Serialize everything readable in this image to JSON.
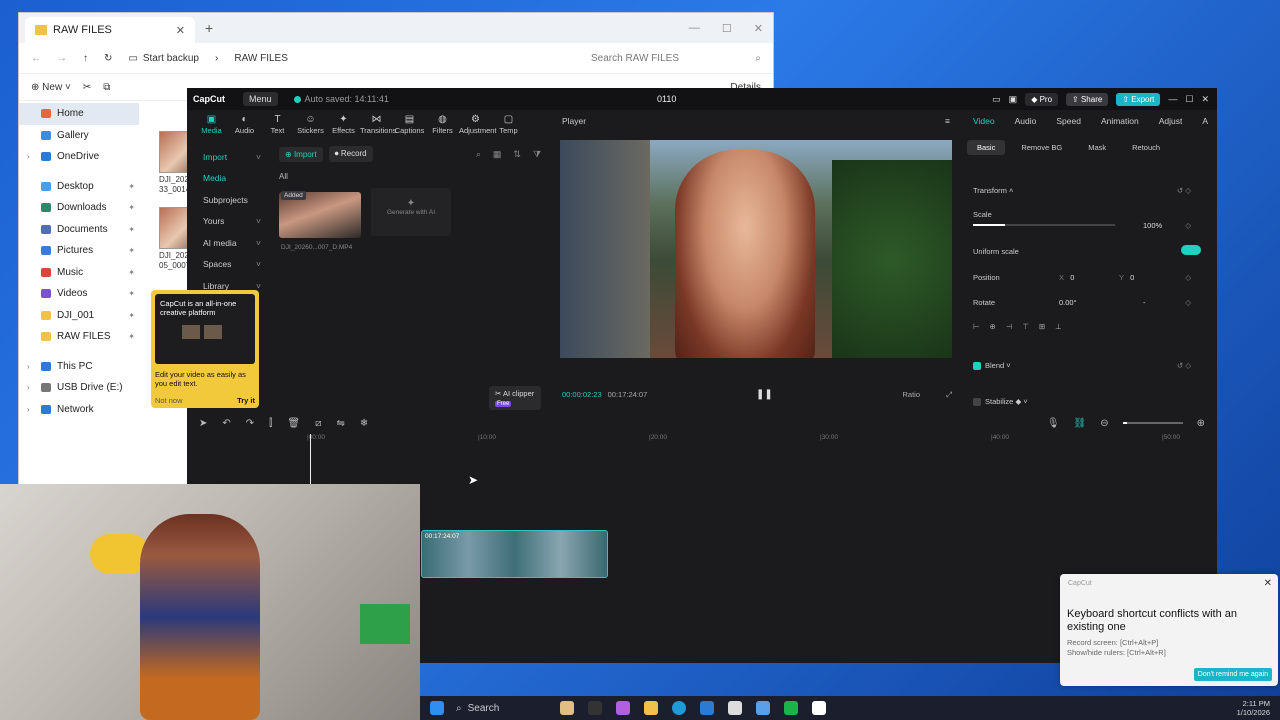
{
  "explorer": {
    "tab_title": "RAW FILES",
    "breadcrumb_backup": "Start backup",
    "breadcrumb_folder": "RAW FILES",
    "search_placeholder": "Search RAW FILES",
    "new_label": "New",
    "details_label": "Details",
    "sidebar": [
      {
        "label": "Home",
        "color": "#e26a3a",
        "selected": true
      },
      {
        "label": "Gallery",
        "color": "#3a8de2"
      },
      {
        "label": "OneDrive",
        "color": "#2d79d3"
      },
      {
        "label": "Desktop",
        "color": "#4a9ee8"
      },
      {
        "label": "Downloads",
        "color": "#2c8a6a"
      },
      {
        "label": "Documents",
        "color": "#4f6fb5"
      },
      {
        "label": "Pictures",
        "color": "#3a7ad8"
      },
      {
        "label": "Music",
        "color": "#d8473a"
      },
      {
        "label": "Videos",
        "color": "#7b52c8"
      },
      {
        "label": "DJI_001",
        "color": "#f2c14b"
      },
      {
        "label": "RAW FILES",
        "color": "#f2c14b"
      },
      {
        "label": "This PC",
        "color": "#2d79d3"
      },
      {
        "label": "USB Drive (E:)",
        "color": "#777"
      },
      {
        "label": "Network",
        "color": "#2d79d3"
      }
    ],
    "files": [
      {
        "name1": "DJI_20260109",
        "name2": "33_0014_D"
      },
      {
        "name1": "DJI_20260109",
        "name2": "05_0007_D"
      }
    ]
  },
  "capcut": {
    "logo": "CapCut",
    "menu": "Menu",
    "autosave": "Auto saved: 14:11:41",
    "project": "0110",
    "pro": "Pro",
    "share": "Share",
    "export": "Export",
    "tools": [
      "Media",
      "Audio",
      "Text",
      "Stickers",
      "Effects",
      "Transitions",
      "Captions",
      "Filters",
      "Adjustment",
      "Temp"
    ],
    "left_nav": [
      "Import",
      "Media",
      "Subprojects",
      "Yours",
      "AI media",
      "Spaces",
      "Library"
    ],
    "import_btn": "Import",
    "record_btn": "Record",
    "all_label": "All",
    "added_badge": "Added",
    "clip_name": "DJI_20260...007_D.MP4",
    "generate_ai": "Generate with AI",
    "ai_clipper": "AI clipper",
    "ai_free": "Free",
    "tooltip": {
      "title": "CapCut is an all-in-one creative platform",
      "desc": "Edit your video as easily as you edit text.",
      "not_now": "Not now",
      "try_it": "Try it"
    },
    "player": {
      "title": "Player",
      "current": "00:00:02:23",
      "total": "00:17:24:07",
      "ratio": "Ratio"
    },
    "panel": {
      "tabs": [
        "Video",
        "Audio",
        "Speed",
        "Animation",
        "Adjust",
        "A"
      ],
      "subtabs": [
        "Basic",
        "Remove BG",
        "Mask",
        "Retouch"
      ],
      "transform": "Transform",
      "scale": "Scale",
      "scale_val": "100%",
      "uniform": "Uniform scale",
      "position": "Position",
      "pos_x_label": "X",
      "pos_x": "0",
      "pos_y_label": "Y",
      "pos_y": "0",
      "rotate": "Rotate",
      "rotate_val": "0.00°",
      "rotate_dash": "-",
      "blend": "Blend",
      "stabilize": "Stabilize"
    },
    "ruler": [
      "|00:00",
      "|10:00",
      "|20:00",
      "|30:00",
      "|40:00",
      "|50:00"
    ],
    "track_timecode": "00:17:24:07"
  },
  "toast": {
    "app": "CapCut",
    "title": "Keyboard shortcut conflicts with an existing one",
    "line1": "Record screen: [Ctrl+Alt+P]",
    "line2": "Show/hide rulers: [Ctrl+Alt+R]",
    "button": "Don't remind me again"
  },
  "taskbar": {
    "search": "Search",
    "time": "2:11 PM",
    "date": "1/10/2026"
  }
}
